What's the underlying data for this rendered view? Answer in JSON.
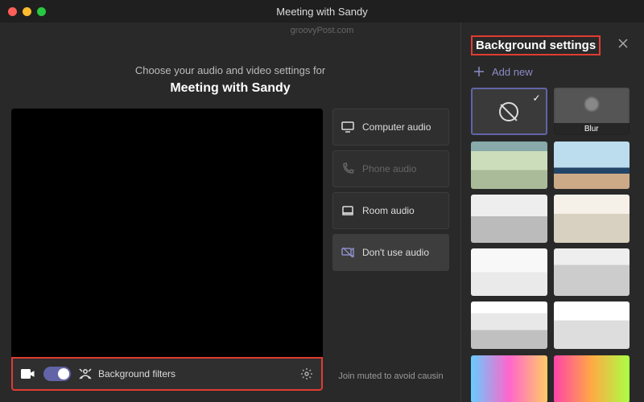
{
  "titlebar": {
    "title": "Meeting with Sandy"
  },
  "watermark": "groovyPost.com",
  "prejoin": {
    "instruction": "Choose your audio and video settings for",
    "meeting_name": "Meeting with Sandy",
    "background_filters_label": "Background filters",
    "audio_options": {
      "computer": "Computer audio",
      "phone": "Phone audio",
      "room": "Room audio",
      "none": "Don't use audio"
    },
    "join_muted_tip": "Join muted to avoid causin"
  },
  "panel": {
    "title": "Background settings",
    "add_new_label": "Add new",
    "thumbs": {
      "none": "None",
      "blur": "Blur"
    }
  },
  "colors": {
    "accent": "#6264a7",
    "highlight": "#e03c31"
  }
}
